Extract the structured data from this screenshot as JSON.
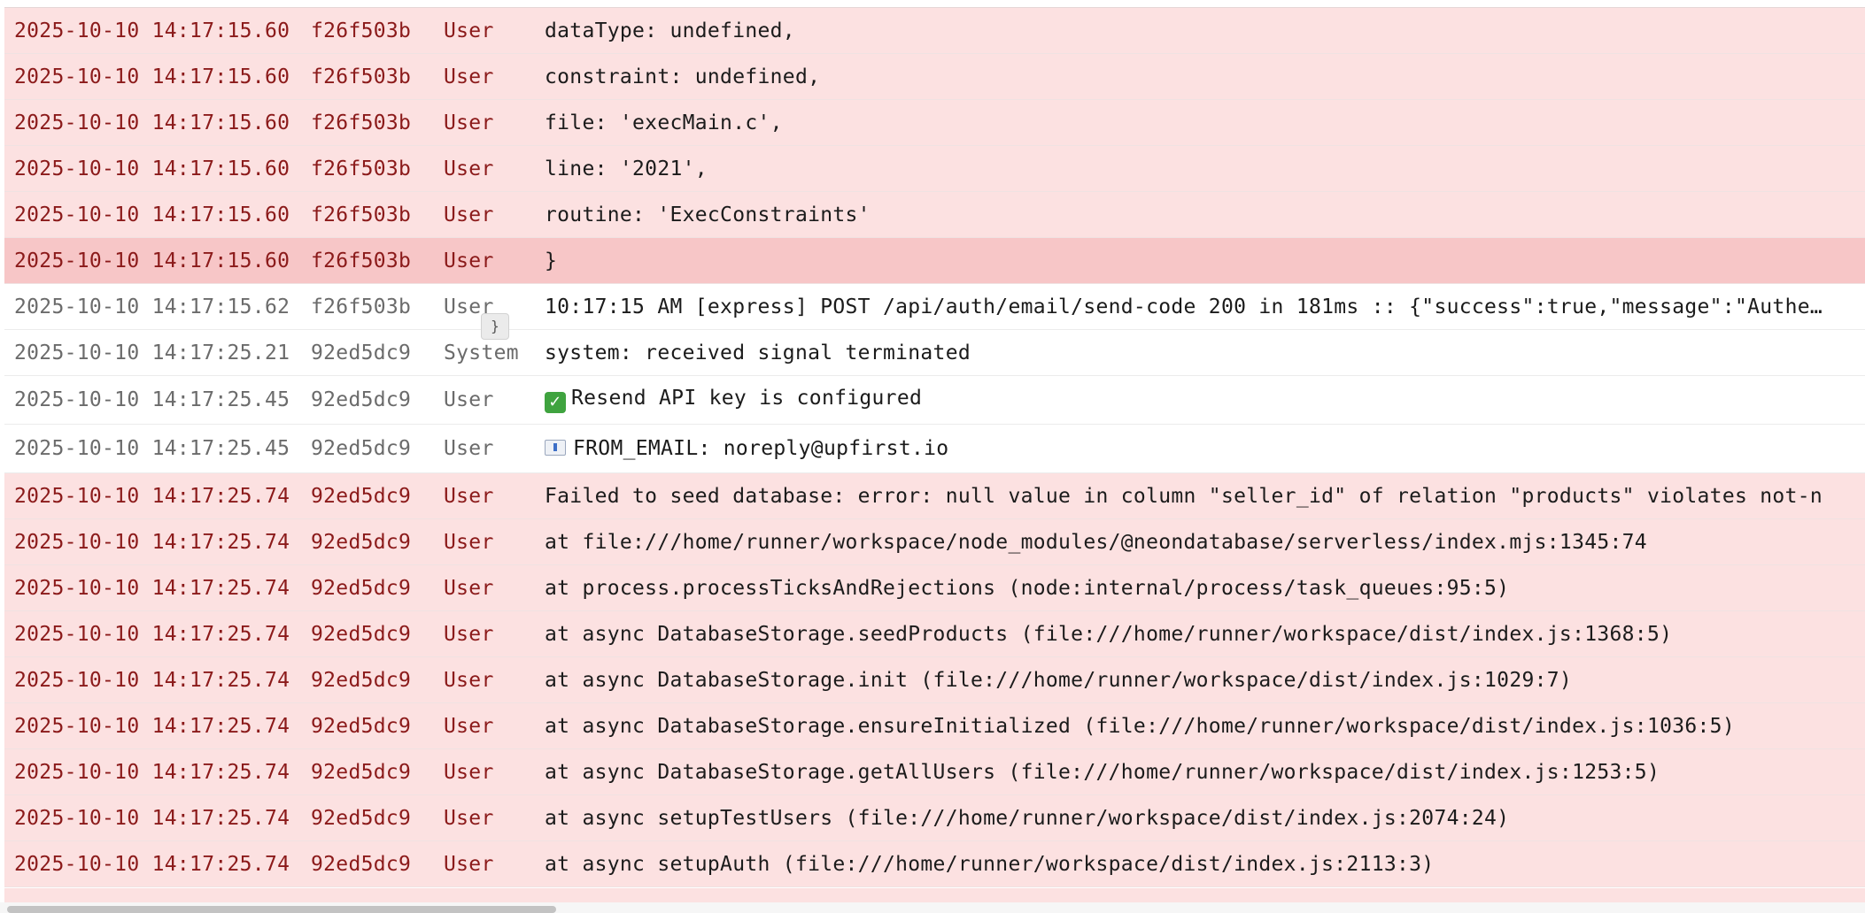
{
  "log": {
    "rows": [
      {
        "time": "2025-10-10 14:17:15.60",
        "id": "f26f503b",
        "source": "User",
        "message": "dataType: undefined,"
      },
      {
        "time": "2025-10-10 14:17:15.60",
        "id": "f26f503b",
        "source": "User",
        "message": "constraint: undefined,"
      },
      {
        "time": "2025-10-10 14:17:15.60",
        "id": "f26f503b",
        "source": "User",
        "message": "file: 'execMain.c',"
      },
      {
        "time": "2025-10-10 14:17:15.60",
        "id": "f26f503b",
        "source": "User",
        "message": "line: '2021',"
      },
      {
        "time": "2025-10-10 14:17:15.60",
        "id": "f26f503b",
        "source": "User",
        "message": "routine: 'ExecConstraints'"
      },
      {
        "time": "2025-10-10 14:17:15.60",
        "id": "f26f503b",
        "source": "User",
        "message": "}"
      },
      {
        "time": "2025-10-10 14:17:15.62",
        "id": "f26f503b",
        "source": "User",
        "message": "10:17:15 AM [express] POST /api/auth/email/send-code 200 in 181ms :: {\"success\":true,\"message\":\"Authe…"
      },
      {
        "time": "2025-10-10 14:17:25.21",
        "id": "92ed5dc9",
        "source": "System",
        "message": "system: received signal terminated"
      },
      {
        "time": "2025-10-10 14:17:25.45",
        "id": "92ed5dc9",
        "source": "User",
        "message": "Resend API key is configured"
      },
      {
        "time": "2025-10-10 14:17:25.45",
        "id": "92ed5dc9",
        "source": "User",
        "message": "FROM_EMAIL: noreply@upfirst.io"
      },
      {
        "time": "2025-10-10 14:17:25.74",
        "id": "92ed5dc9",
        "source": "User",
        "message": "Failed to seed database: error: null value in column \"seller_id\" of relation \"products\" violates not-n"
      },
      {
        "time": "2025-10-10 14:17:25.74",
        "id": "92ed5dc9",
        "source": "User",
        "message": "at file:///home/runner/workspace/node_modules/@neondatabase/serverless/index.mjs:1345:74"
      },
      {
        "time": "2025-10-10 14:17:25.74",
        "id": "92ed5dc9",
        "source": "User",
        "message": "at process.processTicksAndRejections (node:internal/process/task_queues:95:5)"
      },
      {
        "time": "2025-10-10 14:17:25.74",
        "id": "92ed5dc9",
        "source": "User",
        "message": "at async DatabaseStorage.seedProducts (file:///home/runner/workspace/dist/index.js:1368:5)"
      },
      {
        "time": "2025-10-10 14:17:25.74",
        "id": "92ed5dc9",
        "source": "User",
        "message": "at async DatabaseStorage.init (file:///home/runner/workspace/dist/index.js:1029:7)"
      },
      {
        "time": "2025-10-10 14:17:25.74",
        "id": "92ed5dc9",
        "source": "User",
        "message": "at async DatabaseStorage.ensureInitialized (file:///home/runner/workspace/dist/index.js:1036:5)"
      },
      {
        "time": "2025-10-10 14:17:25.74",
        "id": "92ed5dc9",
        "source": "User",
        "message": "at async DatabaseStorage.getAllUsers (file:///home/runner/workspace/dist/index.js:1253:5)"
      },
      {
        "time": "2025-10-10 14:17:25.74",
        "id": "92ed5dc9",
        "source": "User",
        "message": "at async setupTestUsers (file:///home/runner/workspace/dist/index.js:2074:24)"
      },
      {
        "time": "2025-10-10 14:17:25.74",
        "id": "92ed5dc9",
        "source": "User",
        "message": "at async setupAuth (file:///home/runner/workspace/dist/index.js:2113:3)"
      }
    ],
    "tooltip_text": "}"
  },
  "icons": {
    "check": "check-icon",
    "mail": "mail-icon"
  },
  "colors": {
    "error_row_bg": "#fce1e1",
    "selected_row_bg": "#f7c6c7",
    "error_text": "#8b1a1a",
    "info_text": "#6b6b6b"
  }
}
